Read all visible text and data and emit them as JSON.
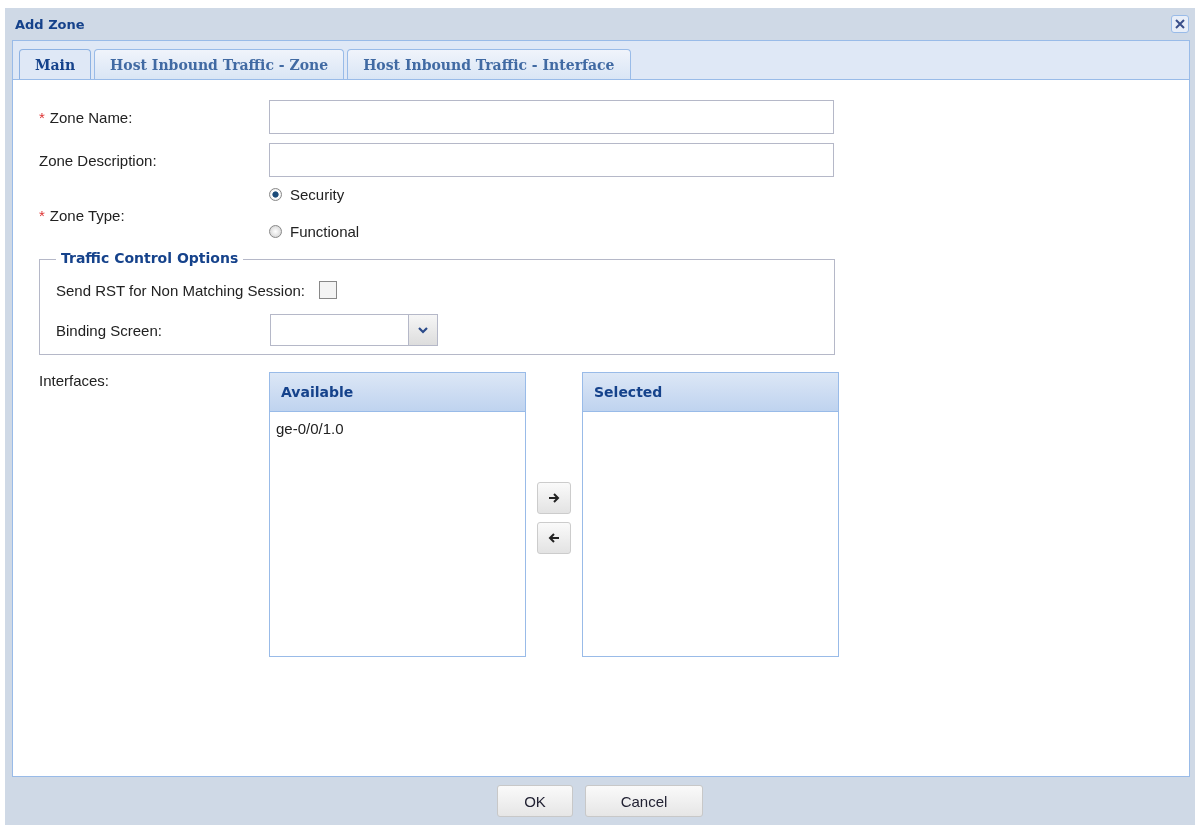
{
  "window": {
    "title": "Add Zone"
  },
  "tabs": [
    {
      "label": "Main",
      "selected": true
    },
    {
      "label": "Host Inbound Traffic - Zone",
      "selected": false
    },
    {
      "label": "Host Inbound Traffic - Interface",
      "selected": false
    }
  ],
  "fields": [
    {
      "label": "Zone Name:",
      "required_mark": "*"
    },
    {
      "label": "Zone Description:"
    }
  ],
  "zone_type": {
    "label": "Zone Type:",
    "required_mark": "*",
    "options": [
      {
        "label": "Security",
        "selected": true
      },
      {
        "label": "Functional",
        "selected": false
      }
    ]
  },
  "traffic_control": {
    "legend": "Traffic Control Options",
    "send_rst": {
      "label": "Send RST for Non Matching Session:",
      "checked": false
    },
    "binding_screen": {
      "label": "Binding Screen:"
    }
  },
  "interfaces": {
    "label": "Interfaces:",
    "available": {
      "header": "Available",
      "items": [
        "ge-0/0/1.0"
      ]
    },
    "selected": {
      "header": "Selected"
    }
  },
  "buttons": [
    "OK",
    "Cancel"
  ]
}
